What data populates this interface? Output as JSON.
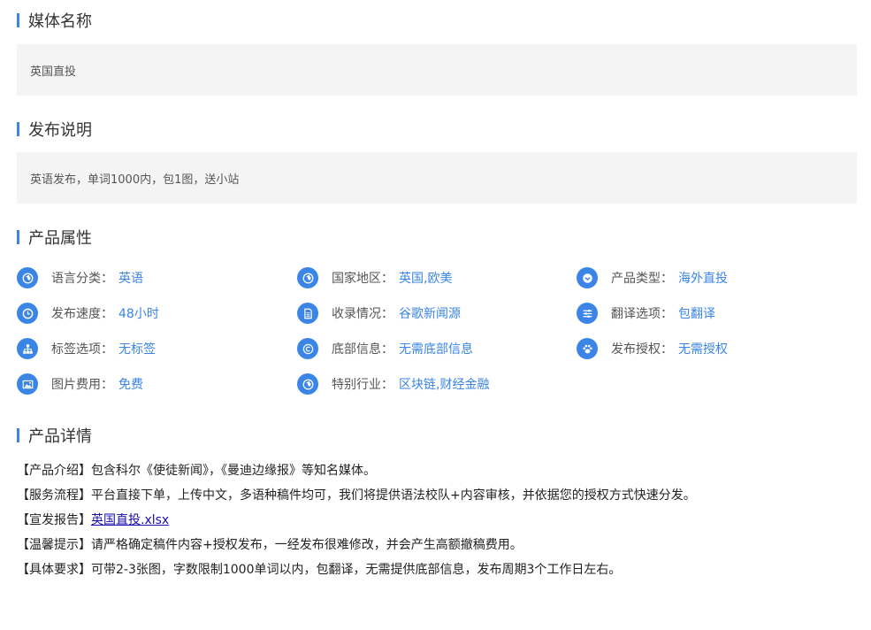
{
  "media_name": {
    "title": "媒体名称",
    "value": "英国直投"
  },
  "description": {
    "title": "发布说明",
    "value": "英语发布，单词1000内，包1图，送小站"
  },
  "attributes": {
    "title": "产品属性",
    "items": [
      {
        "icon": "globe-icon",
        "label": "语言分类：",
        "value": "英语"
      },
      {
        "icon": "globe-icon",
        "label": "国家地区：",
        "value": "英国,欧美"
      },
      {
        "icon": "chevron-down-icon",
        "label": "产品类型：",
        "value": "海外直投"
      },
      {
        "icon": "clock-icon",
        "label": "发布速度：",
        "value": "48小时"
      },
      {
        "icon": "document-icon",
        "label": "收录情况：",
        "value": "谷歌新闻源"
      },
      {
        "icon": "sliders-icon",
        "label": "翻译选项：",
        "value": "包翻译"
      },
      {
        "icon": "sitemap-icon",
        "label": "标签选项：",
        "value": "无标签"
      },
      {
        "icon": "copyright-icon",
        "label": "底部信息：",
        "value": "无需底部信息"
      },
      {
        "icon": "paw-icon",
        "label": "发布授权：",
        "value": "无需授权"
      },
      {
        "icon": "image-icon",
        "label": "图片费用：",
        "value": "免费"
      },
      {
        "icon": "globe-icon",
        "label": "特别行业：",
        "value": "区块链,财经金融"
      }
    ]
  },
  "details": {
    "title": "产品详情",
    "lines": [
      {
        "tag": "【产品介绍】",
        "text": "包含科尔《使徒新闻》，《曼迪边缘报》等知名媒体。"
      },
      {
        "tag": "【服务流程】",
        "text": "平台直接下单，上传中文，多语种稿件均可，我们将提供语法校队+内容审核，并依据您的授权方式快速分发。"
      },
      {
        "tag": "【宣发报告】",
        "link": "英国直投.xlsx"
      },
      {
        "tag": "【温馨提示】",
        "text": "请严格确定稿件内容+授权发布，一经发布很难修改，并会产生高额撤稿费用。"
      },
      {
        "tag": "【具体要求】",
        "text": "可带2-3张图，字数限制1000单词以内，包翻译，无需提供底部信息，发布周期3个工作日左右。"
      }
    ]
  },
  "colors": {
    "accent": "#3a85e6",
    "box_bg": "#f4f4f4",
    "link": "#1a0dab"
  }
}
